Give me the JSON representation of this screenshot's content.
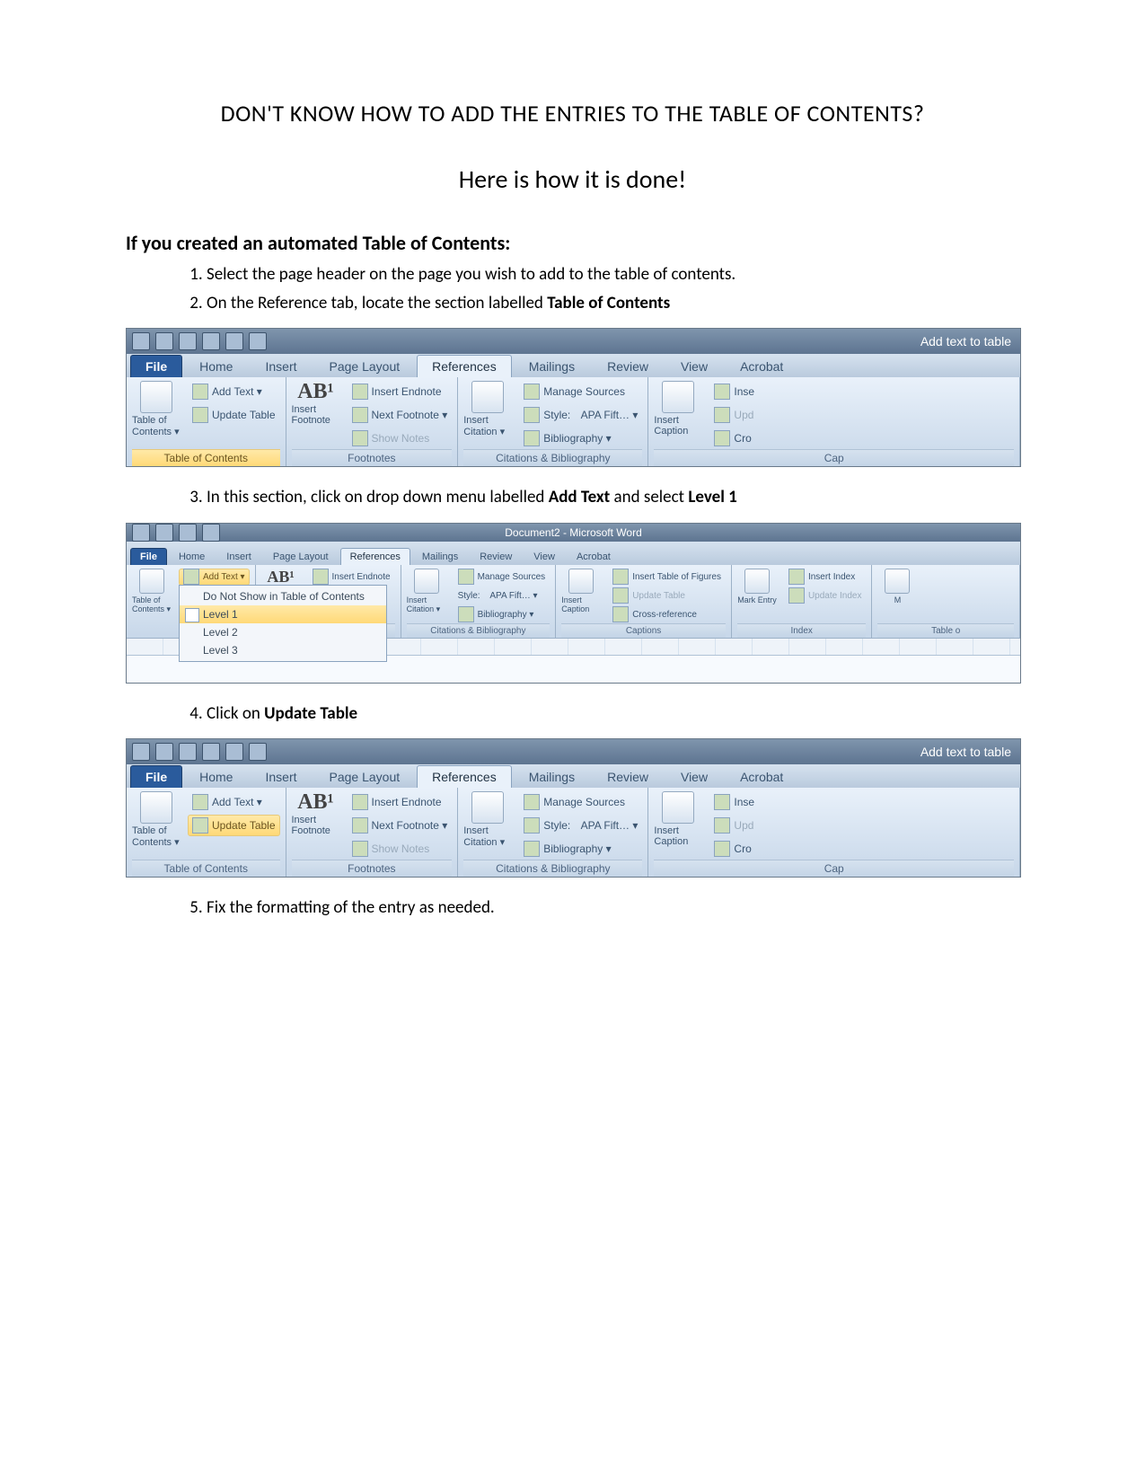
{
  "document": {
    "heading_line1_pre": "D",
    "heading_line1_rest": "ON'T KNOW HOW TO ADD THE ENTRIES TO THE TABLE OF CONTENTS?",
    "heading_line2": "Here is how it is done!",
    "section_heading": "If you created an automated Table of Contents:",
    "steps": {
      "s1": "Select the page header on the page you wish to add to the table of contents.",
      "s2_pre": "On the Reference tab, locate the section labelled ",
      "s2_bold": "Table of Contents",
      "s3_pre": "In this section, click on drop down menu labelled ",
      "s3_bold1": "Add Text",
      "s3_mid": " and select ",
      "s3_bold2": "Level 1",
      "s4_pre": "Click on ",
      "s4_bold": "Update Table",
      "s5": "Fix the formatting of the entry as needed."
    }
  },
  "ribbon_common": {
    "tabs": {
      "file": "File",
      "home": "Home",
      "insert": "Insert",
      "page_layout": "Page Layout",
      "references": "References",
      "mailings": "Mailings",
      "review": "Review",
      "view": "View",
      "acrobat": "Acrobat"
    },
    "title_right": "Add text to table",
    "toc": {
      "big_label": "Table of Contents ▾",
      "add_text": "Add Text ▾",
      "update_table": "Update Table",
      "group_label": "Table of Contents"
    },
    "footnotes": {
      "big_label": "Insert Footnote",
      "big_letters": "AB¹",
      "insert_endnote": "Insert Endnote",
      "next_footnote": "Next Footnote ▾",
      "show_notes": "Show Notes",
      "group_label": "Footnotes"
    },
    "citations": {
      "big_label": "Insert Citation ▾",
      "manage_sources": "Manage Sources",
      "style_label": "Style:",
      "style_value": "APA Fift… ▾",
      "bibliography": "Bibliography ▾",
      "group_label": "Citations & Bibliography"
    },
    "captions": {
      "big_label": "Insert Caption",
      "insert_tof": "Insert Table of Figures",
      "update_table": "Update Table",
      "cross_ref": "Cross-reference",
      "group_label": "Captions",
      "group_label_short": "Cap",
      "inse": "Inse",
      "upd": "Upd",
      "cro": "Cro"
    },
    "index": {
      "big_label": "Mark Entry",
      "insert_index": "Insert Index",
      "update_index": "Update Index",
      "group_label": "Index"
    },
    "toa": {
      "big_label_short": "M",
      "group_label_short": "Table o"
    }
  },
  "ribbon2": {
    "window_title_center": "Document2 - Microsoft Word",
    "add_text_menu": {
      "opt0": "Do Not Show in Table of Contents",
      "opt1": "Level 1",
      "opt2": "Level 2",
      "opt3": "Level 3"
    }
  }
}
